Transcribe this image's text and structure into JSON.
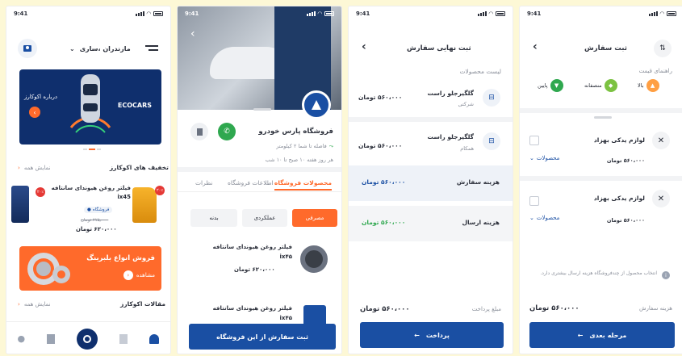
{
  "status_time": "9:41",
  "home": {
    "location": "مازندران ،ساری",
    "banner_title": "ECOCARS",
    "banner_button": "درباره اکوکارز",
    "discounts_title": "تخفیف های اکوکارز",
    "show_all": "نمایش همه",
    "product_name": "فیلتر روغن هیوندای سانتافه ix45",
    "shop_tag": "فروشگاه",
    "old_price": "۲۷۵٫۰۰۰ تومان",
    "price": "۶۲۰،۰۰۰ تومان",
    "discount_badge": "۲۰٪",
    "promo_title": "فروش انواع بلبرینگ",
    "promo_button": "مشاهده",
    "articles_title": "مقالات اکوکارز",
    "articles_show_all": "نمایش همه"
  },
  "shop": {
    "name": "فروشگاه پارس خودرو",
    "distance": "فاصله تا شما ۲ کیلومتر",
    "hours": "هر روز هفته ۱۰ صبح تا ۱۰ شب",
    "tabs": [
      "محصولات فروشگاه",
      "اطلاعات فروشگاه",
      "نظرات"
    ],
    "filters": [
      "مصرفی",
      "عملکردی",
      "بدنه"
    ],
    "products": [
      {
        "name": "فیلتر روغن هیوندای سانتافه ix۴۵",
        "price": "۶۲۰،۰۰۰ تومان"
      },
      {
        "name": "فیلتر روغن هیوندای سانتافه ix۴۵"
      }
    ],
    "order_button": "ثبت سفارش از این فروشگاه"
  },
  "final": {
    "title": "ثبت نهایی سفارش",
    "list_title": "لیست محصولات",
    "items": [
      {
        "name": "گلگیرجلو راست",
        "sub": "شرکتی",
        "price": "۵۶۰،۰۰۰ تومان"
      },
      {
        "name": "گلگیرجلو راست",
        "sub": "همکام",
        "price": "۵۶۰،۰۰۰ تومان"
      }
    ],
    "order_cost_label": "هزینه سفارش",
    "order_cost": "۵۶۰،۰۰۰ تومان",
    "shipping_label": "هزینه ارسال",
    "shipping_cost": "۵۶۰،۰۰۰ تومان",
    "pay_label": "مبلغ پرداخت",
    "pay_amount": "۵۶۰،۰۰۰ تومان",
    "pay_button": "پرداخت"
  },
  "order": {
    "title": "ثبت سفارش",
    "guide_title": "راهنمای قیمت",
    "guide": [
      "بالا",
      "منصفانه",
      "پایین"
    ],
    "shops": [
      {
        "name": "لوازم یدکی بهزاد",
        "price": "۵۶۰،۰۰۰ تومان",
        "products": "محصولات"
      },
      {
        "name": "لوازم یدکی بهزاد",
        "price": "۵۶۰،۰۰۰ تومان",
        "products": "محصولات"
      }
    ],
    "info": "انتخاب محصول از چندفروشگاه هزینه ارسال بیشتری دارد.",
    "total_label": "هزینه سفارش",
    "total": "۵۶۰،۰۰۰ تومان",
    "next_button": "مرحله بعدی"
  },
  "colors": {
    "primary": "#1a4fa3",
    "orange": "#ff6a2b",
    "green": "#2fa84f",
    "red": "#e53935"
  }
}
